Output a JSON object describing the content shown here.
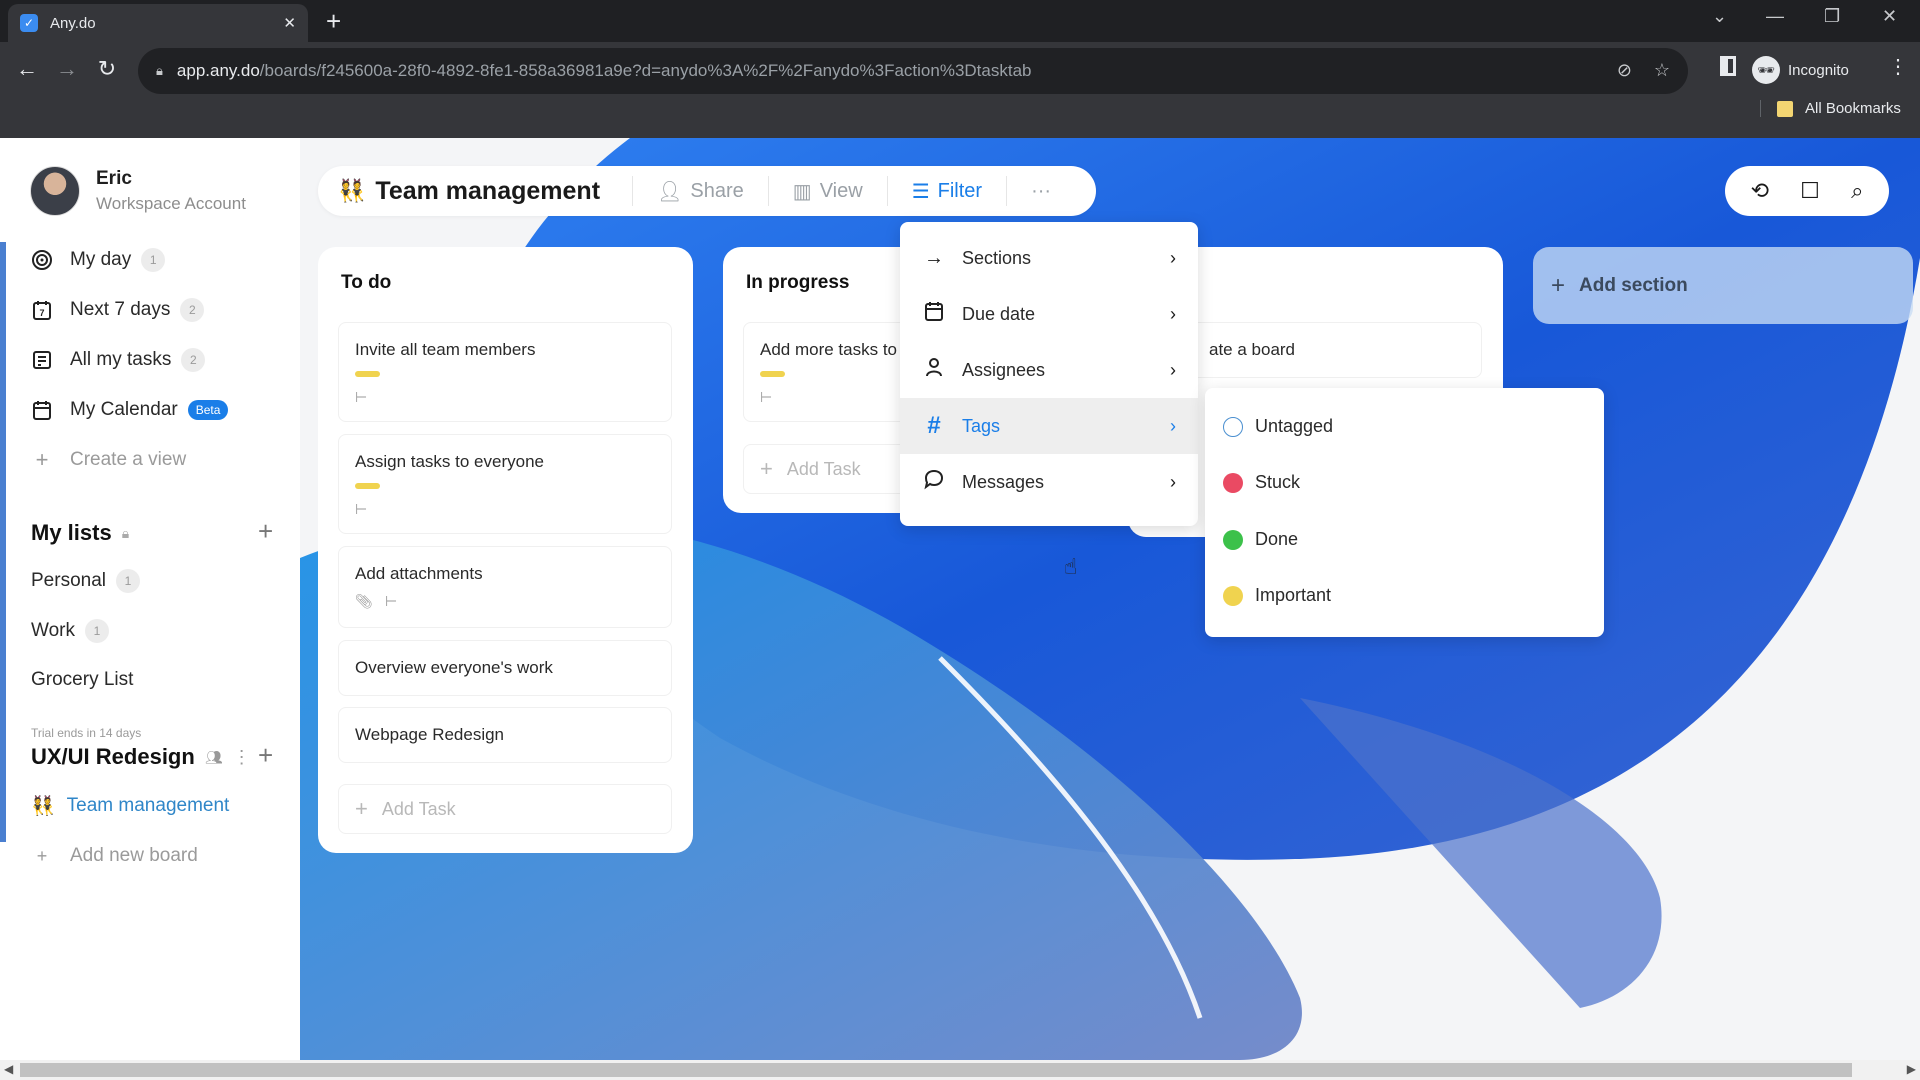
{
  "browser": {
    "tab_title": "Any.do",
    "url_host": "app.any.do",
    "url_path": "/boards/f245600a-28f0-4892-8fe1-858a36981a9e?d=anydo%3A%2F%2Fanydo%3Faction%3Dtasktab",
    "profile_label": "Incognito",
    "bookmarks_label": "All Bookmarks"
  },
  "user": {
    "name": "Eric",
    "account_type": "Workspace Account"
  },
  "sidebar": {
    "views": [
      {
        "label": "My day",
        "count": "1",
        "icon": "target-icon"
      },
      {
        "label": "Next 7 days",
        "count": "2",
        "icon": "calendar-7-icon"
      },
      {
        "label": "All my tasks",
        "count": "2",
        "icon": "list-icon"
      },
      {
        "label": "My Calendar",
        "badge": "Beta",
        "icon": "calendar-icon"
      }
    ],
    "create_view_label": "Create a view",
    "my_lists_title": "My lists",
    "lists": [
      {
        "label": "Personal",
        "count": "1"
      },
      {
        "label": "Work",
        "count": "1"
      },
      {
        "label": "Grocery List"
      }
    ],
    "trial_text": "Trial ends in 14 days",
    "workspace_title": "UX/UI Redesign",
    "boards": [
      {
        "label": "Team management",
        "emoji": "👯"
      }
    ],
    "add_board_label": "Add new board"
  },
  "board": {
    "emoji": "👯",
    "title": "Team management",
    "share_label": "Share",
    "view_label": "View",
    "filter_label": "Filter",
    "more_label": "···"
  },
  "columns": [
    {
      "title": "To do",
      "cards": [
        {
          "title": "Invite all team members",
          "tag_color": "#f0d34f",
          "subtasks": true
        },
        {
          "title": "Assign tasks to everyone",
          "tag_color": "#f0d34f",
          "subtasks": true
        },
        {
          "title": "Add attachments",
          "attachment": true,
          "subtasks": true
        },
        {
          "title": "Overview everyone's work"
        },
        {
          "title": "Webpage Redesign"
        }
      ],
      "add_task_label": "Add Task"
    },
    {
      "title": "In progress",
      "cards": [
        {
          "title": "Add more tasks to",
          "tag_color": "#f0d34f",
          "subtasks": true
        }
      ],
      "add_task_label": "Add Task"
    },
    {
      "title": "",
      "cards": [
        {
          "title": "ate a board"
        }
      ]
    }
  ],
  "add_section_label": "Add section",
  "filter_menu": {
    "items": [
      {
        "label": "Sections",
        "icon": "arrow-right-icon"
      },
      {
        "label": "Due date",
        "icon": "calendar-icon"
      },
      {
        "label": "Assignees",
        "icon": "person-icon"
      },
      {
        "label": "Tags",
        "icon": "hash-icon",
        "active": true
      },
      {
        "label": "Messages",
        "icon": "chat-bubble-icon"
      }
    ]
  },
  "tags_menu": {
    "items": [
      {
        "label": "Untagged",
        "color": "#ffffff",
        "outline": "#4a8fd0"
      },
      {
        "label": "Stuck",
        "color": "#ea4a63"
      },
      {
        "label": "Done",
        "color": "#3cc14a"
      },
      {
        "label": "Important",
        "color": "#f0d34f"
      }
    ]
  },
  "colors": {
    "accent": "#1a7ee8",
    "tag_yellow": "#f0d34f"
  }
}
